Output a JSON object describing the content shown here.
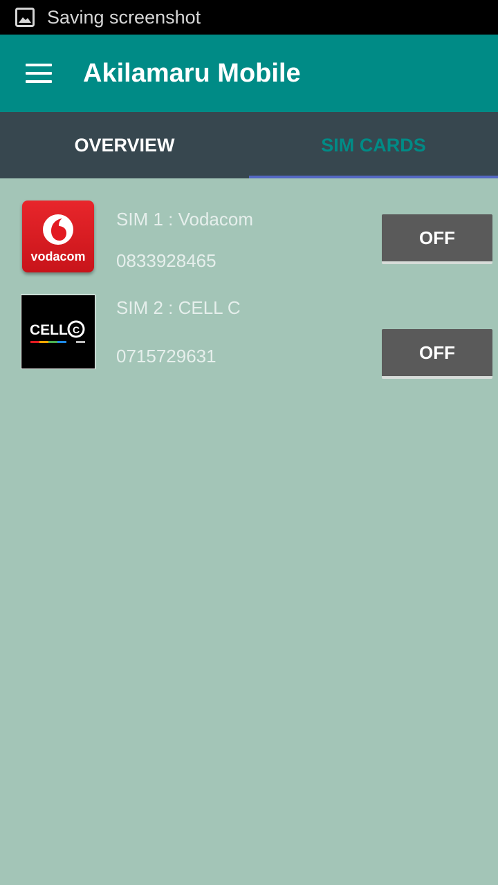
{
  "status_bar": {
    "text": "Saving screenshot",
    "icon": "image-icon"
  },
  "app_bar": {
    "title": "Akilamaru Mobile",
    "menu_icon": "hamburger-menu-icon",
    "color": "#008b86"
  },
  "tabs": [
    {
      "label": "OVERVIEW",
      "selected": false
    },
    {
      "label": "SIM CARDS",
      "selected": true
    }
  ],
  "sims": [
    {
      "name": "SIM 1 : Vodacom",
      "number": "0833928465",
      "toggle_label": "OFF",
      "logo": "vodacom-logo",
      "logo_text": "vodacom"
    },
    {
      "name": "SIM 2 : CELL C",
      "number": "0715729631",
      "toggle_label": "OFF",
      "logo": "cellc-logo",
      "logo_text": "CELL C"
    }
  ],
  "colors": {
    "background": "#a3c5b7",
    "tab_bar": "#37474f",
    "tab_indicator": "#5468c4",
    "toggle": "#5a5a5a"
  }
}
